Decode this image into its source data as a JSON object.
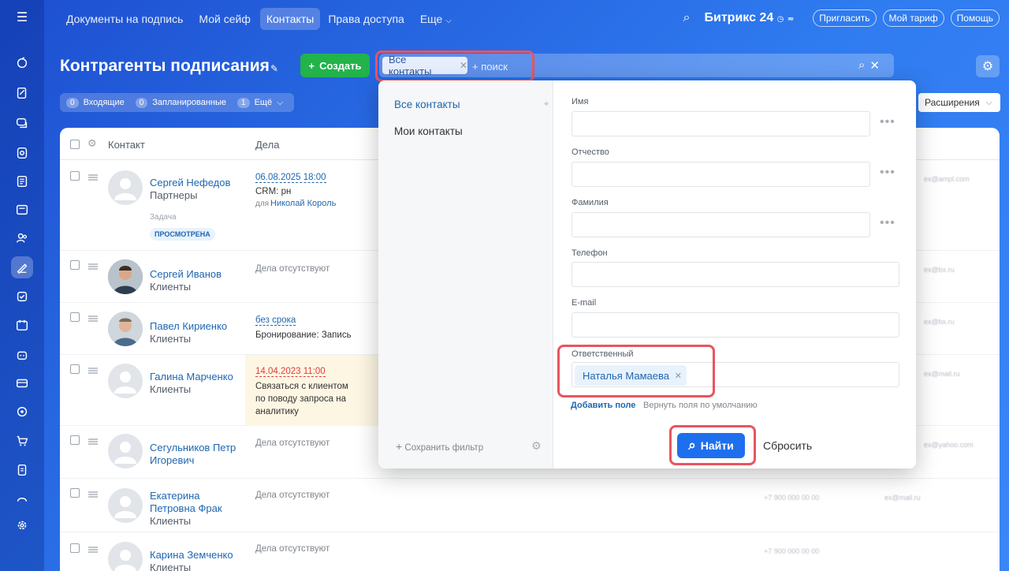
{
  "topnav": {
    "tabs": [
      "Документы на подпись",
      "Мой сейф",
      "Контакты",
      "Права доступа",
      "Еще"
    ],
    "active_tab": "Контакты",
    "brand": "Битрикс 24",
    "buttons": [
      "Пригласить",
      "Мой тариф",
      "Помощь"
    ]
  },
  "page": {
    "title": "Контрагенты подписания",
    "create_label": "Создать",
    "settings_icon": "gear-icon"
  },
  "search": {
    "chip_label": "Все контакты",
    "placeholder": "+ поиск"
  },
  "counters": {
    "items": [
      {
        "count": "0",
        "label": "Входящие"
      },
      {
        "count": "0",
        "label": "Запланированные"
      },
      {
        "count": "1",
        "label": "Ещё"
      }
    ]
  },
  "extensions_label": "Расширения",
  "table": {
    "headers": {
      "contact": "Контакт",
      "deals": "Дела"
    },
    "rows": [
      {
        "name": "Сергей Нефедов",
        "type": "Партнеры",
        "deal_date": "06.08.2025 18:00",
        "deal_text": "CRM: рн",
        "deal_for_prefix": "для",
        "deal_for": "Николай Король",
        "task_label": "Задача",
        "task_badge": "ПРОСМОТРЕНА",
        "blur_phone": "",
        "blur_email": "ex@ampl.com"
      },
      {
        "name": "Сергей Иванов",
        "type": "Клиенты",
        "deal_none": "Дела отсутствуют",
        "blur_email": "ex@bx.ru"
      },
      {
        "name": "Павел Кириенко",
        "type": "Клиенты",
        "deal_date": "без срока",
        "deal_text": "Бронирование: Запись",
        "blur_email": "ex@bx.ru"
      },
      {
        "name": "Галина Марченко",
        "type": "Клиенты",
        "deal_date": "14.04.2023 11:00",
        "deal_text_lines": [
          "Связаться с клиентом",
          "по поводу запроса на",
          "аналитику"
        ],
        "blur_email": "ex@mail.ru"
      },
      {
        "name_lines": [
          "Сегульников Петр",
          "Игоревич"
        ],
        "deal_none": "Дела отсутствуют",
        "blur_email": "ex@yahoo.com"
      },
      {
        "name_lines": [
          "Екатерина",
          "Петровна Фрак"
        ],
        "type": "Клиенты",
        "deal_none": "Дела отсутствуют",
        "blur_phone": "+7 900 000 00 00",
        "blur_email": "ex@mail.ru"
      },
      {
        "name": "Карина Земченко",
        "type": "Клиенты",
        "deal_none": "Дела отсутствуют",
        "blur_phone": "+7 900 000 00 00"
      }
    ]
  },
  "filter": {
    "presets": [
      "Все контакты",
      "Мои контакты"
    ],
    "save_filter": "Сохранить фильтр",
    "fields": [
      {
        "label": "Имя"
      },
      {
        "label": "Отчество"
      },
      {
        "label": "Фамилия"
      },
      {
        "label": "Телефон"
      },
      {
        "label": "E-mail"
      }
    ],
    "responsible_label": "Ответственный",
    "responsible_value": "Наталья Мамаева",
    "add_field": "Добавить поле",
    "restore_fields": "Вернуть поля по умолчанию",
    "find_label": "Найти",
    "reset_label": "Сбросить"
  },
  "colors": {
    "accent": "#1e6fee",
    "create": "#22b34b",
    "highlight": "#e8555f",
    "link": "#2067b0"
  }
}
